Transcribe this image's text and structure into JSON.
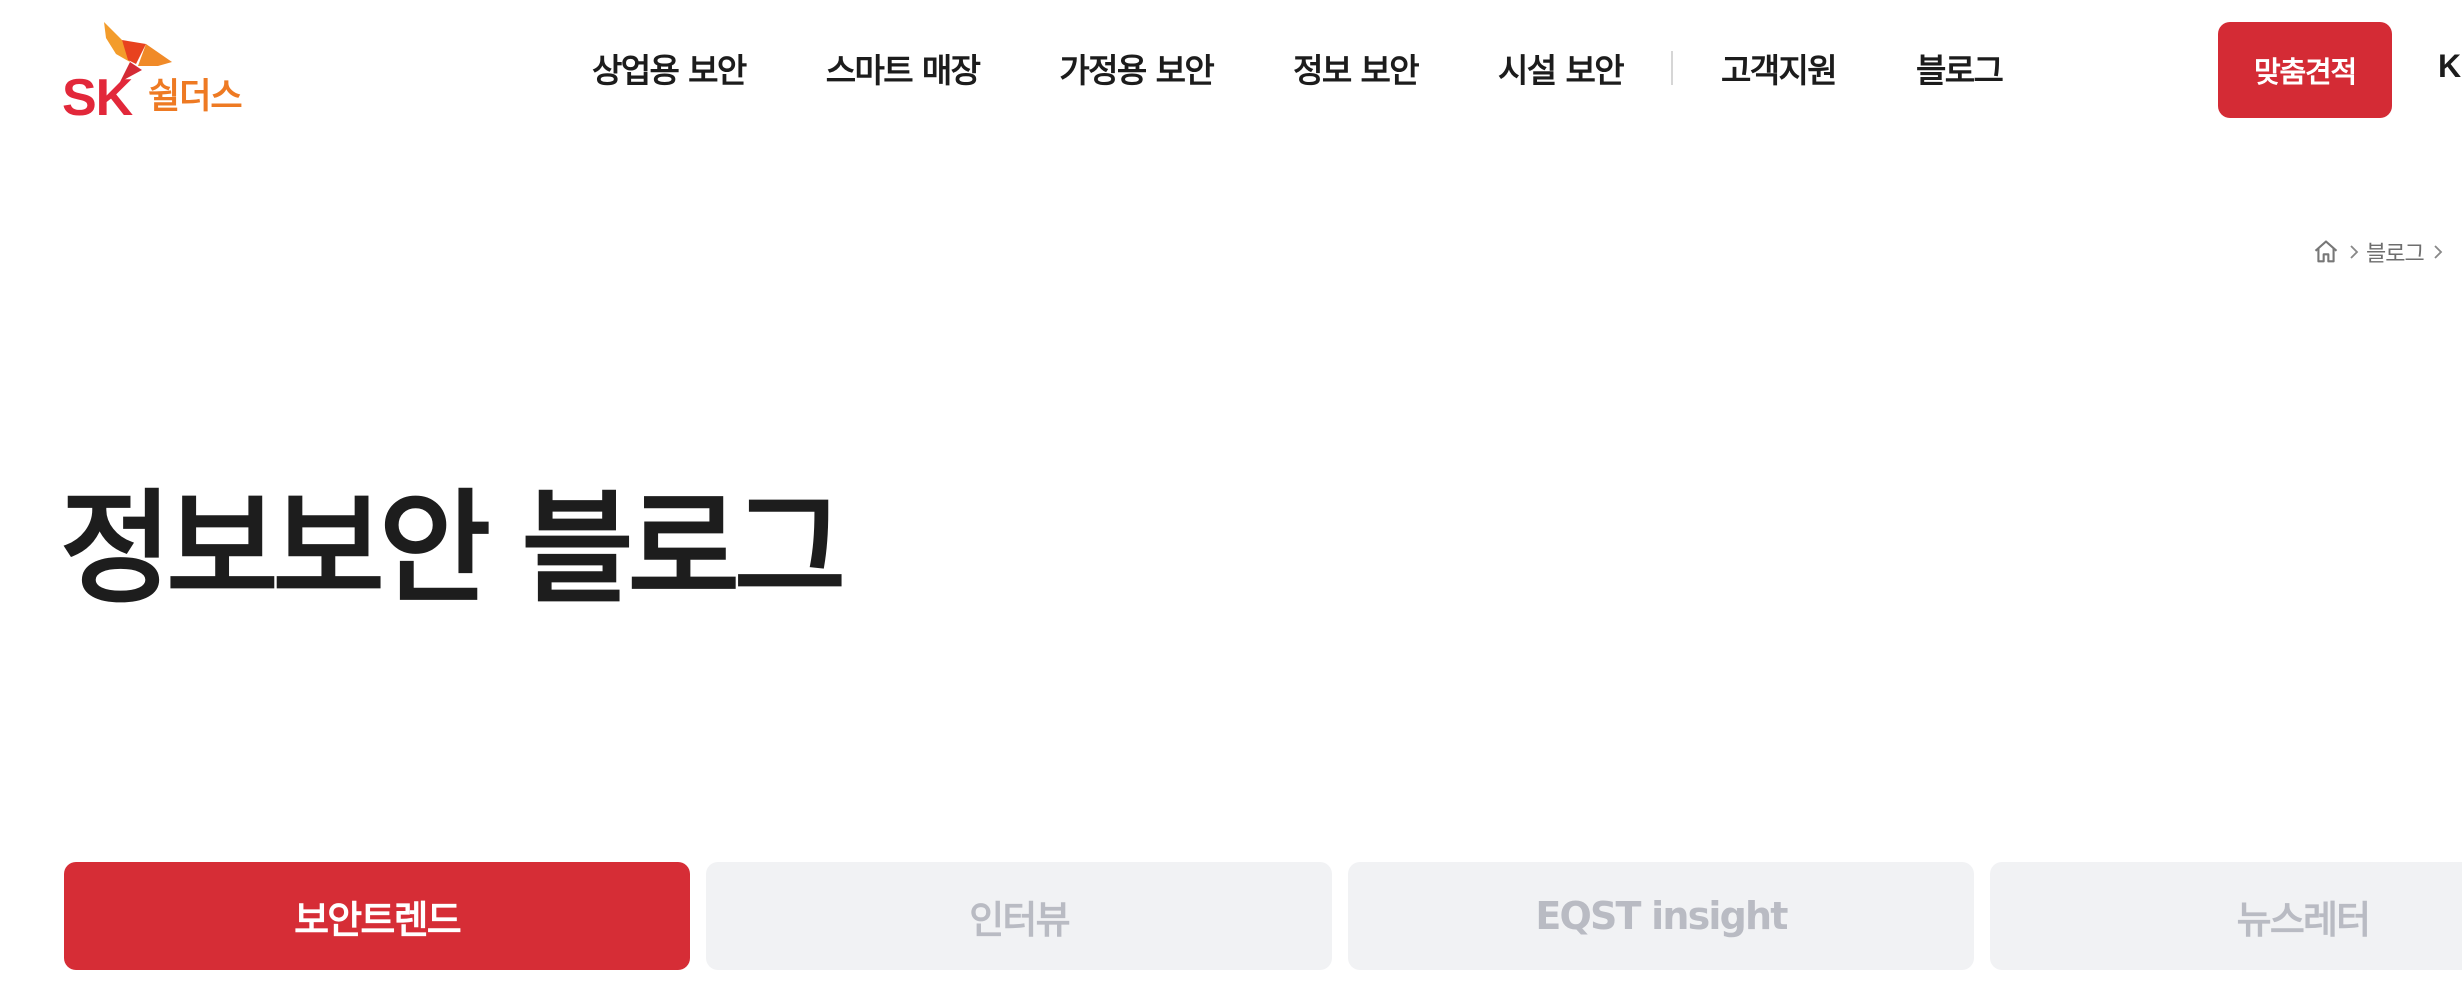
{
  "header": {
    "logo": {
      "brand": "SK",
      "product": "쉴더스"
    },
    "nav": [
      {
        "label": "상업용 보안"
      },
      {
        "label": "스마트 매장"
      },
      {
        "label": "가정용 보안"
      },
      {
        "label": "정보 보안"
      },
      {
        "label": "시설 보안"
      },
      {
        "label": "고객지원"
      },
      {
        "label": "블로그"
      }
    ],
    "quote_button": "맞춤견적",
    "language": "KR"
  },
  "breadcrumb": {
    "home_icon": "home-icon",
    "items": [
      "블로그"
    ]
  },
  "title": "정보보안 블로그",
  "tabs": [
    {
      "label": "보안트렌드",
      "active": true
    },
    {
      "label": "인터뷰",
      "active": false
    },
    {
      "label": "EQST insight",
      "active": false
    },
    {
      "label": "뉴스레터",
      "active": false
    }
  ],
  "colors": {
    "brand_red": "#d42b35",
    "brand_orange": "#ee7a23",
    "tab_inactive_bg": "#f1f2f4",
    "tab_inactive_text": "#b9bbc3"
  }
}
